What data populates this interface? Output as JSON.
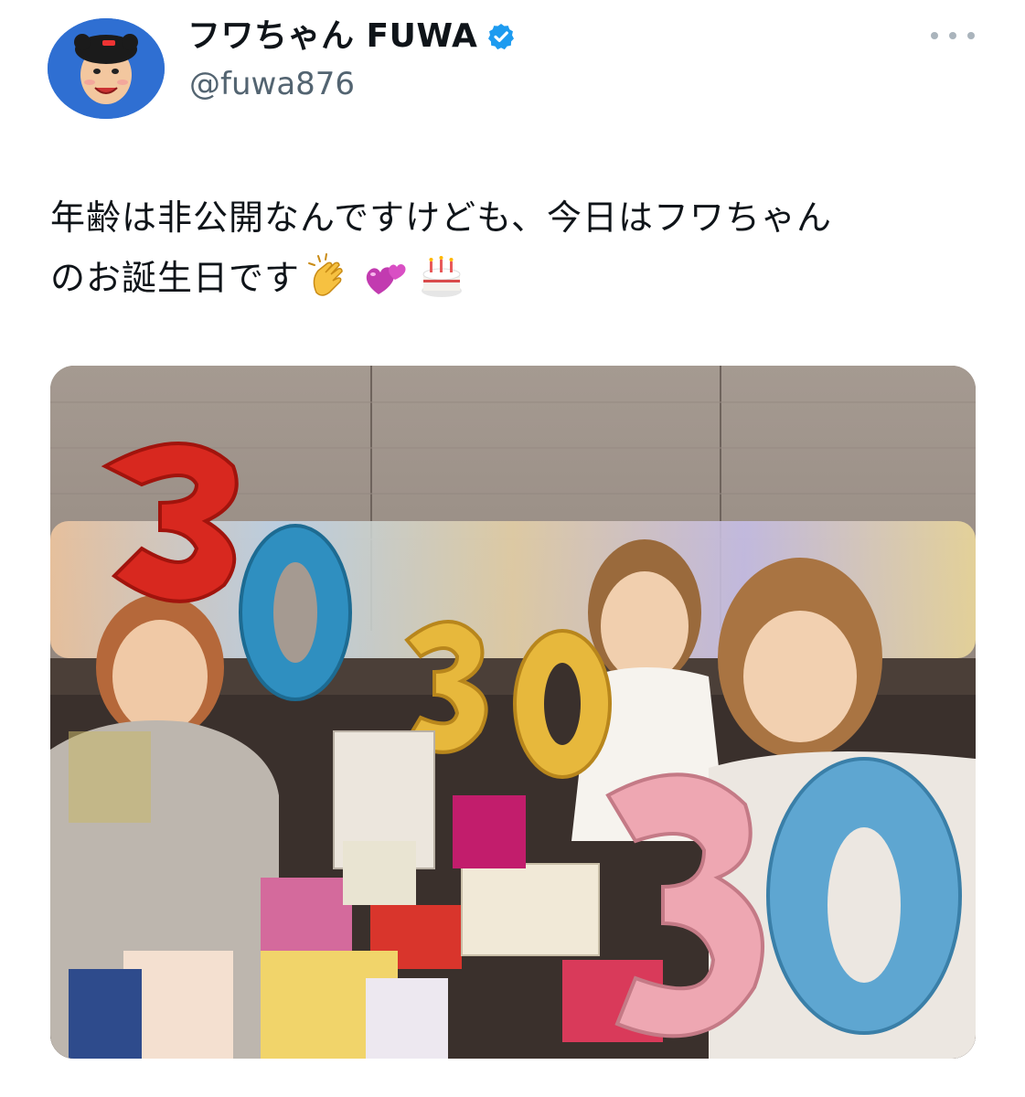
{
  "tweet": {
    "author": {
      "display_name": "フワちゃん FUWA",
      "handle": "@fuwa876",
      "verified": true
    },
    "text_line1": "年齢は非公開なんですけども、今日はフワちゃん",
    "text_line2": "のお誕生日です",
    "emojis": [
      "clapping-hands-icon",
      "two-hearts-icon",
      "birthday-cake-icon"
    ]
  },
  "photo": {
    "balloon_numbers": [
      "30",
      "30",
      "30"
    ]
  },
  "colors": {
    "verified_badge": "#1d9bf0",
    "handle_text": "#536471",
    "avatar_bg": "#2f6fd2"
  }
}
